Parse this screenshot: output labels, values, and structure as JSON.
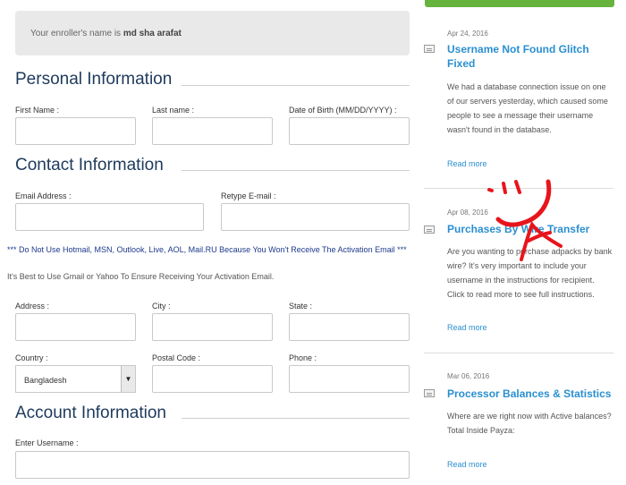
{
  "enroller": {
    "prefix": "Your enroller's name is",
    "name": "md sha arafat"
  },
  "personal": {
    "title": "Personal Information",
    "first_name_label": "First Name :",
    "last_name_label": "Last name :",
    "dob_label": "Date of Birth (MM/DD/YYYY) :"
  },
  "contact": {
    "title": "Contact Information",
    "email_label": "Email Address :",
    "retype_email_label": "Retype E-mail :",
    "warning": "*** Do Not Use Hotmail, MSN, Outlook, Live, AOL, Mail.RU Because You Won't Receive The Activation Email ***",
    "hint": "It's Best to Use Gmail or Yahoo To Ensure Receiving Your Activation Email.",
    "address_label": "Address :",
    "city_label": "City :",
    "state_label": "State :",
    "country_label": "Country :",
    "country_value": "Bangladesh",
    "postal_label": "Postal Code :",
    "phone_label": "Phone :"
  },
  "account": {
    "title": "Account Information",
    "username_label": "Enter Username :"
  },
  "sidebar": {
    "posts": [
      {
        "date": "Apr 24, 2016",
        "title": "Username Not Found Glitch Fixed",
        "body": "We had a database connection issue on one of our servers yesterday, which caused some people to see a message their username wasn't found in the database.",
        "more": "Read more"
      },
      {
        "date": "Apr 08, 2016",
        "title": "Purchases By Wire Transfer",
        "body": "Are you wanting to purchase adpacks by bank wire? It's very important to include your username in the instructions for recipient. Click to read more to see full instructions.",
        "more": "Read more"
      },
      {
        "date": "Mar 06, 2016",
        "title": "Processor Balances & Statistics",
        "body": "Where are we right now with Active balances?\nTotal Inside Payza:",
        "more": "Read more"
      }
    ]
  },
  "colors": {
    "accent": "#2a8fd0",
    "heading": "#1e3a5c",
    "green": "#66b33d",
    "annotation": "#e8141c"
  }
}
